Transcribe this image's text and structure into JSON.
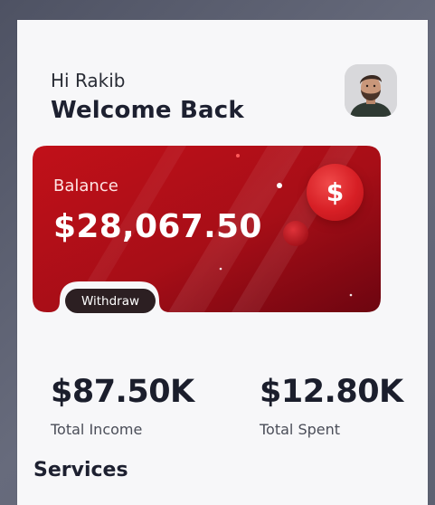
{
  "header": {
    "greeting": "Hi Rakib",
    "welcome": "Welcome Back"
  },
  "balance_card": {
    "label": "Balance",
    "amount": "$28,067.50",
    "currency_symbol": "$",
    "withdraw_label": "Withdraw",
    "accent_color": "#c0121b",
    "dark_color": "#7e0510"
  },
  "stats": {
    "income": {
      "value": "$87.50K",
      "label": "Total Income"
    },
    "spent": {
      "value": "$12.80K",
      "label": "Total Spent"
    }
  },
  "services": {
    "title": "Services"
  }
}
